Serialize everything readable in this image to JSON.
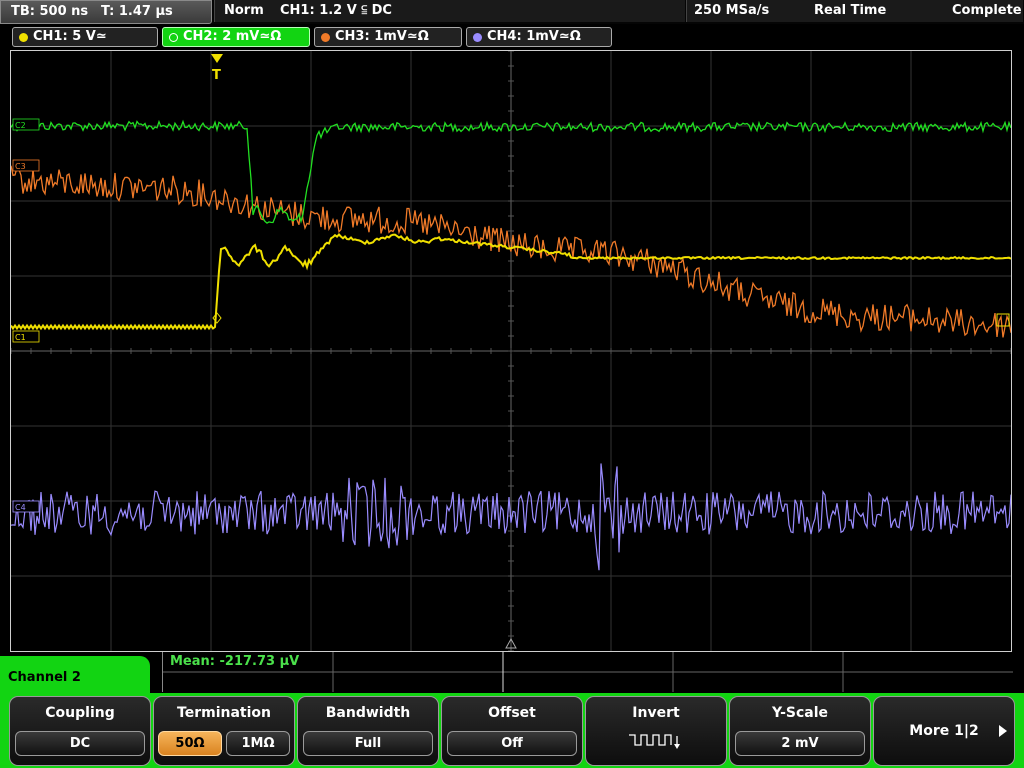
{
  "top": {
    "timebase": "TB: 500 ns",
    "trigger_time": "T: 1.47 µs",
    "trigger_mode": "Norm",
    "trigger_source": "CH1: 1.2 V ⫅ DC",
    "sample_rate": "250 MSa/s",
    "acq_mode": "Real Time",
    "status": "Complete"
  },
  "channels": [
    {
      "label": "CH1: 5 V≃",
      "color": "#f0e000"
    },
    {
      "label": "CH2: 2 mV≃Ω",
      "color": "#12d412"
    },
    {
      "label": "CH3: 1mV≃Ω",
      "color": "#f07a28"
    },
    {
      "label": "CH4: 1mV≃Ω",
      "color": "#9a8cff"
    }
  ],
  "screen": {
    "trigger_marker": "T",
    "ch_markers": {
      "c2": "C2",
      "c3": "C3",
      "c1": "C1",
      "c4": "C4"
    }
  },
  "measurement": {
    "mean": "Mean: -217.73 µV"
  },
  "menu": {
    "title": "Channel 2",
    "coupling": {
      "title": "Coupling",
      "value": "DC"
    },
    "termination": {
      "title": "Termination",
      "option1": "50Ω",
      "option2": "1MΩ"
    },
    "bandwidth": {
      "title": "Bandwidth",
      "value": "Full"
    },
    "offset": {
      "title": "Offset",
      "value": "Off"
    },
    "invert": {
      "title": "Invert"
    },
    "yscale": {
      "title": "Y-Scale",
      "value": "2 mV"
    },
    "more": {
      "label": "More 1|2"
    }
  }
}
